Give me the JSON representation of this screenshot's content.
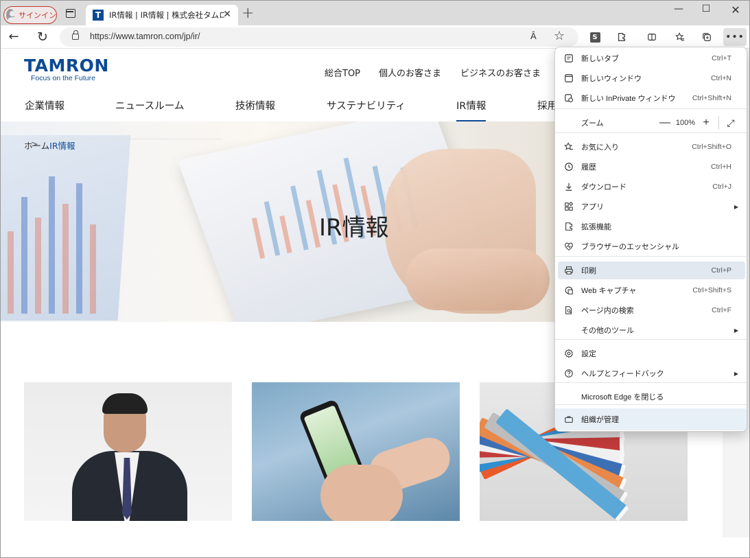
{
  "browser": {
    "signin_label": "サインイン",
    "tab_title": "IR情報 | IR情報 | 株式会社タムロン",
    "favicon_letter": "T",
    "url": "https://www.tamron.com/jp/ir/",
    "read_aloud_glyph": "Ȃ",
    "extension_letter": "S"
  },
  "site": {
    "logo": "TAMRON",
    "tagline": "Focus on the Future",
    "top_nav": [
      "総合TOP",
      "個人のお客さま",
      "ビジネスのお客さま"
    ],
    "main_nav": [
      "企業情報",
      "ニュースルーム",
      "技術情報",
      "サステナビリティ",
      "IR情報",
      "採用"
    ],
    "active_nav": "IR情報",
    "breadcrumb": {
      "home": "ホーム",
      "separator": ">",
      "current": "IR情報"
    },
    "hero_title": "IR情報"
  },
  "menu": {
    "items": [
      {
        "icon": "new-tab-icon",
        "label": "新しいタブ",
        "shortcut": "Ctrl+T"
      },
      {
        "icon": "new-window-icon",
        "label": "新しいウィンドウ",
        "shortcut": "Ctrl+N"
      },
      {
        "icon": "inprivate-icon",
        "label": "新しい InPrivate ウィンドウ",
        "shortcut": "Ctrl+Shift+N"
      },
      {
        "icon": "",
        "label": "ズーム",
        "shortcut": ""
      },
      {
        "icon": "favorites-icon",
        "label": "お気に入り",
        "shortcut": "Ctrl+Shift+O"
      },
      {
        "icon": "history-icon",
        "label": "履歴",
        "shortcut": "Ctrl+H"
      },
      {
        "icon": "download-icon",
        "label": "ダウンロード",
        "shortcut": "Ctrl+J"
      },
      {
        "icon": "apps-icon",
        "label": "アプリ",
        "shortcut": ""
      },
      {
        "icon": "extensions-icon",
        "label": "拡張機能",
        "shortcut": ""
      },
      {
        "icon": "essentials-icon",
        "label": "ブラウザーのエッセンシャル",
        "shortcut": ""
      },
      {
        "icon": "print-icon",
        "label": "印刷",
        "shortcut": "Ctrl+P"
      },
      {
        "icon": "web-capture-icon",
        "label": "Web キャプチャ",
        "shortcut": "Ctrl+Shift+S"
      },
      {
        "icon": "find-icon",
        "label": "ページ内の検索",
        "shortcut": "Ctrl+F"
      },
      {
        "icon": "",
        "label": "その他のツール",
        "shortcut": ""
      },
      {
        "icon": "settings-icon",
        "label": "設定",
        "shortcut": ""
      },
      {
        "icon": "help-icon",
        "label": "ヘルプとフィードバック",
        "shortcut": ""
      },
      {
        "icon": "",
        "label": "Microsoft Edge を閉じる",
        "shortcut": ""
      },
      {
        "icon": "briefcase-icon",
        "label": "組織が管理",
        "shortcut": ""
      }
    ],
    "zoom": {
      "minus": "—",
      "value": "100%",
      "plus": "+",
      "fullscreen": "⤢"
    },
    "submenu_arrow": "▶"
  }
}
